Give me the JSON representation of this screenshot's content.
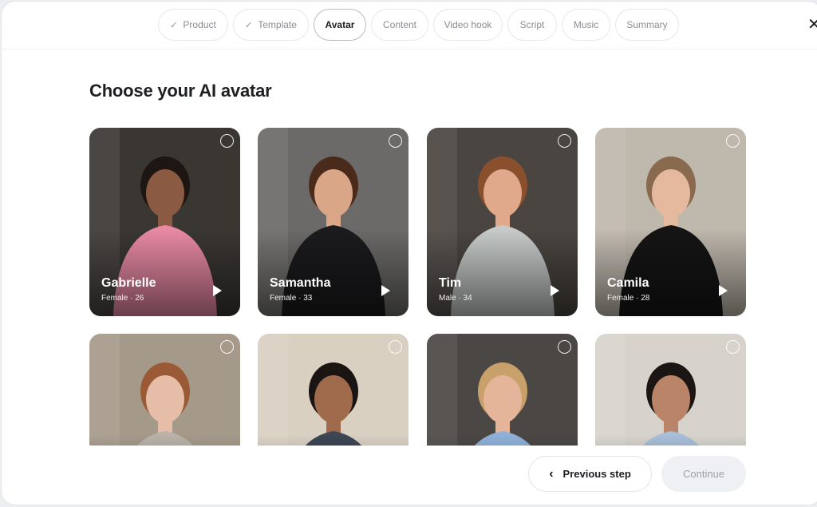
{
  "stepper": {
    "steps": [
      {
        "label": "Product",
        "done": true
      },
      {
        "label": "Template",
        "done": true
      },
      {
        "label": "Avatar",
        "active": true
      },
      {
        "label": "Content"
      },
      {
        "label": "Video hook"
      },
      {
        "label": "Script"
      },
      {
        "label": "Music"
      },
      {
        "label": "Summary"
      }
    ],
    "check_glyph": "✓",
    "close_glyph": "✕"
  },
  "page": {
    "title": "Choose your AI avatar"
  },
  "avatars": [
    {
      "name": "Gabrielle",
      "meta": "Female · 26",
      "colors": {
        "bg": "#3a3733",
        "shirt": "#e98aa4",
        "skin": "#8a5a42",
        "hair": "#1d1612"
      }
    },
    {
      "name": "Samantha",
      "meta": "Female · 33",
      "colors": {
        "bg": "#6b6a68",
        "shirt": "#1b1b1d",
        "skin": "#d9a688",
        "hair": "#4a2b1b"
      }
    },
    {
      "name": "Tim",
      "meta": "Male · 34",
      "colors": {
        "bg": "#4a4540",
        "shirt": "#c7cbc9",
        "skin": "#e0a98c",
        "hair": "#8a4f2c"
      }
    },
    {
      "name": "Camila",
      "meta": "Female · 28",
      "colors": {
        "bg": "#bfb8ad",
        "shirt": "#151515",
        "skin": "#e4b99e",
        "hair": "#8a6a4e"
      }
    },
    {
      "name": "",
      "meta": "",
      "colors": {
        "bg": "#a59a8a",
        "shirt": "#b9b3aa",
        "skin": "#e6bda6",
        "hair": "#9a5a36"
      }
    },
    {
      "name": "",
      "meta": "",
      "colors": {
        "bg": "#d9d0c2",
        "shirt": "#3c4654",
        "skin": "#a06a4c",
        "hair": "#1a1512"
      }
    },
    {
      "name": "",
      "meta": "",
      "colors": {
        "bg": "#4b4744",
        "shirt": "#8fb0d8",
        "skin": "#e5b59a",
        "hair": "#c8a06a"
      }
    },
    {
      "name": "",
      "meta": "",
      "colors": {
        "bg": "#d7d3cc",
        "shirt": "#a8bfd8",
        "skin": "#b98468",
        "hair": "#1b1613"
      }
    }
  ],
  "footer": {
    "prev_label": "Previous step",
    "prev_chevron": "‹",
    "continue_label": "Continue"
  }
}
